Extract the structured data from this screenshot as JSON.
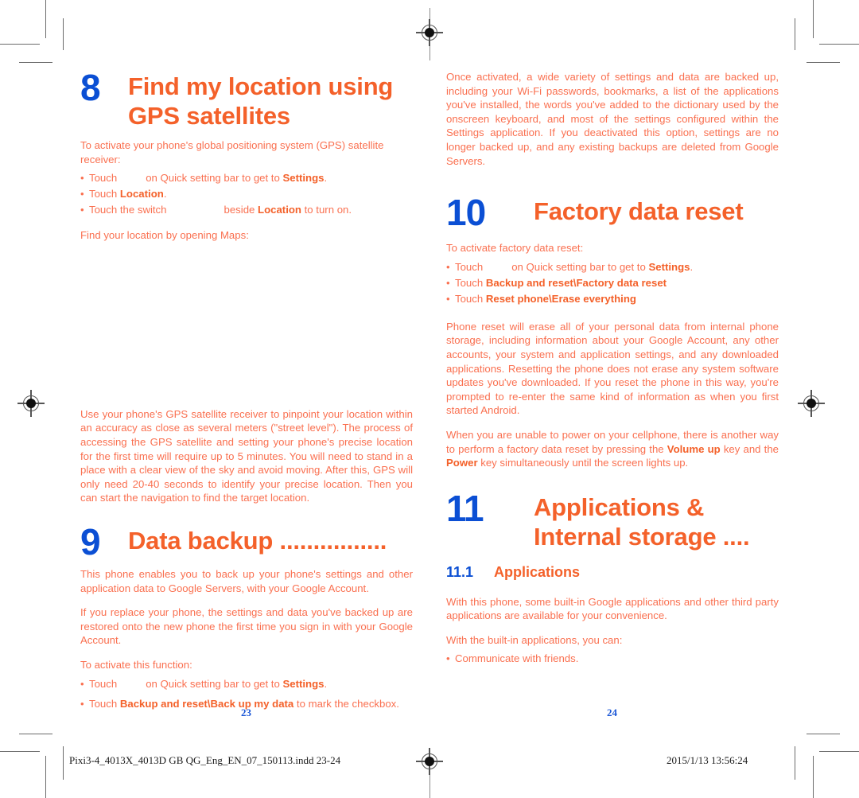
{
  "document": {
    "left_page_number": "23",
    "right_page_number": "24",
    "footer_slug": "Pixi3-4_4013X_4013D GB QG_Eng_EN_07_150113.indd   23-24",
    "footer_timestamp": "2015/1/13   13:56:24",
    "colors": {
      "heading_orange": "#F4612A",
      "body_orange": "#FA7050",
      "number_blue": "#0B4FD4",
      "pagenum_blue": "#1A56D6"
    }
  },
  "left_column": {
    "chapter8": {
      "number": "8",
      "title_line1": "Find my location using",
      "title_line2": "GPS satellites",
      "intro": "To activate your phone's global positioning system (GPS) satellite receiver:",
      "bullets": [
        {
          "pre": "Touch",
          "icon_gap": true,
          "mid": "on Quick setting bar to get to ",
          "bold": "Settings",
          "post": "."
        },
        {
          "pre": "Touch ",
          "icon_gap": false,
          "mid": "",
          "bold": "Location",
          "post": "."
        },
        {
          "pre": "Touch the switch",
          "icon_gap": true,
          "mid": "beside ",
          "bold": "Location",
          "post": " to turn on."
        }
      ],
      "closing": "Find your location by opening Maps:",
      "description": "Use your phone's GPS satellite receiver to pinpoint your location within an accuracy as close as several meters (\"street level\"). The process of accessing the GPS satellite and setting your phone's precise location for the first time will require up to 5 minutes. You will need to stand in a place with a clear view of the sky and avoid moving. After this, GPS will only need 20-40 seconds to identify your precise location. Then you can start the navigation to find the target location."
    },
    "chapter9": {
      "number": "9",
      "title": "Data backup ................",
      "para1": "This phone enables you to back up your phone's settings and other application data to Google Servers, with your Google Account.",
      "para2": "If you replace your phone, the settings and data you've backed up are restored onto the new phone the first time you sign in with your Google Account.",
      "para3": "To activate this function:",
      "bullets": [
        {
          "pre": "Touch",
          "icon_gap": true,
          "mid": "on Quick setting bar to get to ",
          "bold": "Settings",
          "post": "."
        },
        {
          "pre": "Touch ",
          "icon_gap": false,
          "mid": "",
          "bold": "Backup and reset\\Back up my data",
          "post": " to mark the checkbox."
        }
      ]
    }
  },
  "right_column": {
    "backup_continued": "Once activated, a wide variety of settings and data are backed up, including your Wi-Fi passwords, bookmarks, a list of the applications you've installed, the words you've added to the dictionary used by the onscreen keyboard, and most of the settings configured within the Settings application. If you deactivated this option, settings are no longer backed up, and any existing backups are deleted from Google Servers.",
    "chapter10": {
      "number": "10",
      "title": "Factory data reset",
      "intro": "To activate factory data reset:",
      "bullets": [
        {
          "pre": "Touch",
          "icon_gap": true,
          "mid": "on Quick setting bar to get to ",
          "bold": "Settings",
          "post": "."
        },
        {
          "pre": "Touch ",
          "icon_gap": false,
          "mid": "",
          "bold": "Backup and reset\\Factory data reset",
          "post": ""
        },
        {
          "pre": "Touch ",
          "icon_gap": false,
          "mid": "",
          "bold": "Reset phone\\Erase everything",
          "post": ""
        }
      ],
      "para1": "Phone reset will erase all of your personal data from internal phone storage, including information about your Google Account, any other accounts, your system and application settings, and any downloaded applications. Resetting the phone does not erase any system software updates you've downloaded. If you reset the phone in this way, you're prompted to re-enter the same kind of information as when you first started Android.",
      "para2_pre": "When you are unable to power on your cellphone, there is another way to perform a factory data reset by pressing the ",
      "para2_bold1": "Volume up",
      "para2_mid": " key and the ",
      "para2_bold2": "Power",
      "para2_post": " key simultaneously until the screen lights up."
    },
    "chapter11": {
      "number": "11",
      "title_line1": "Applications &",
      "title_line2": "Internal storage ....",
      "subsection_number": "11.1",
      "subsection_title": "Applications",
      "para1": "With this phone, some built-in Google applications and other third party applications are available for your convenience.",
      "para2": "With the built-in applications, you can:",
      "bullets": [
        {
          "pre": "Communicate with friends.",
          "icon_gap": false,
          "mid": "",
          "bold": "",
          "post": ""
        }
      ]
    }
  }
}
